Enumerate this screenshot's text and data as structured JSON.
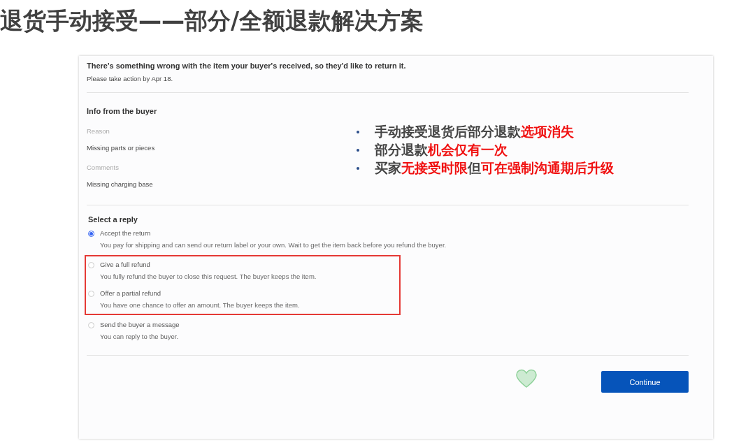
{
  "slide_title": "退货手动接受——部分/全额退款解决方案",
  "panel": {
    "heading": "There's something wrong with the item your buyer's received, so they'd like to return it.",
    "deadline": "Please take action by Apr 18.",
    "info": {
      "title": "Info from the buyer",
      "fields": [
        {
          "label": "Reason",
          "value": "Missing parts or pieces"
        },
        {
          "label": "Comments",
          "value": "Missing charging base"
        }
      ]
    },
    "reply": {
      "title": "Select a reply",
      "options": [
        {
          "label": "Accept the return",
          "description": "You pay for shipping and can send our return label or your own. Wait to get the item back before you refund the buyer.",
          "selected": true,
          "highlighted": false
        },
        {
          "label": "Give a full refund",
          "description": "You fully refund the buyer to close this request. The buyer keeps the item.",
          "selected": false,
          "highlighted": true
        },
        {
          "label": "Offer a partial refund",
          "description": "You have one chance to offer an amount. The buyer keeps the item.",
          "selected": false,
          "highlighted": true
        },
        {
          "label": "Send the buyer a message",
          "description": "You can reply to the buyer.",
          "selected": false,
          "highlighted": false
        }
      ]
    },
    "continue_button": "Continue"
  },
  "notes": [
    [
      {
        "text": "手动接受退货后部分退款",
        "emphasis": false
      },
      {
        "text": "选项消失",
        "emphasis": true
      }
    ],
    [
      {
        "text": "部分退款",
        "emphasis": false
      },
      {
        "text": "机会仅有一次",
        "emphasis": true
      }
    ],
    [
      {
        "text": "买家",
        "emphasis": false
      },
      {
        "text": "无接受时限",
        "emphasis": true
      },
      {
        "text": "但",
        "emphasis": false
      },
      {
        "text": "可在强制沟通期后升级",
        "emphasis": true
      }
    ]
  ]
}
